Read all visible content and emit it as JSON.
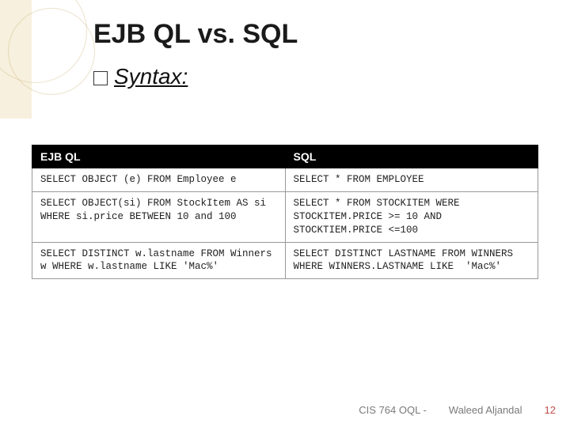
{
  "title": "EJB QL vs. SQL",
  "subtitle": "Syntax:",
  "table": {
    "headers": {
      "left": "EJB QL",
      "right": "SQL"
    },
    "rows": [
      {
        "left": "SELECT OBJECT (e) FROM Employee e",
        "right": "SELECT * FROM EMPLOYEE"
      },
      {
        "left": "SELECT OBJECT(si) FROM StockItem AS si WHERE si.price BETWEEN 10 and 100",
        "right": "SELECT * FROM STOCKITEM WERE STOCKITEM.PRICE >= 10 AND STOCKTIEM.PRICE <=100"
      },
      {
        "left": "SELECT DISTINCT w.lastname FROM Winners w WHERE w.lastname LIKE 'Mac%'",
        "right": "SELECT DISTINCT LASTNAME FROM WINNERS WHERE WINNERS.LASTNAME LIKE  'Mac%'"
      }
    ]
  },
  "footer": {
    "course": "CIS 764 OQL -",
    "author": "Waleed Aljandal",
    "page": "12"
  }
}
